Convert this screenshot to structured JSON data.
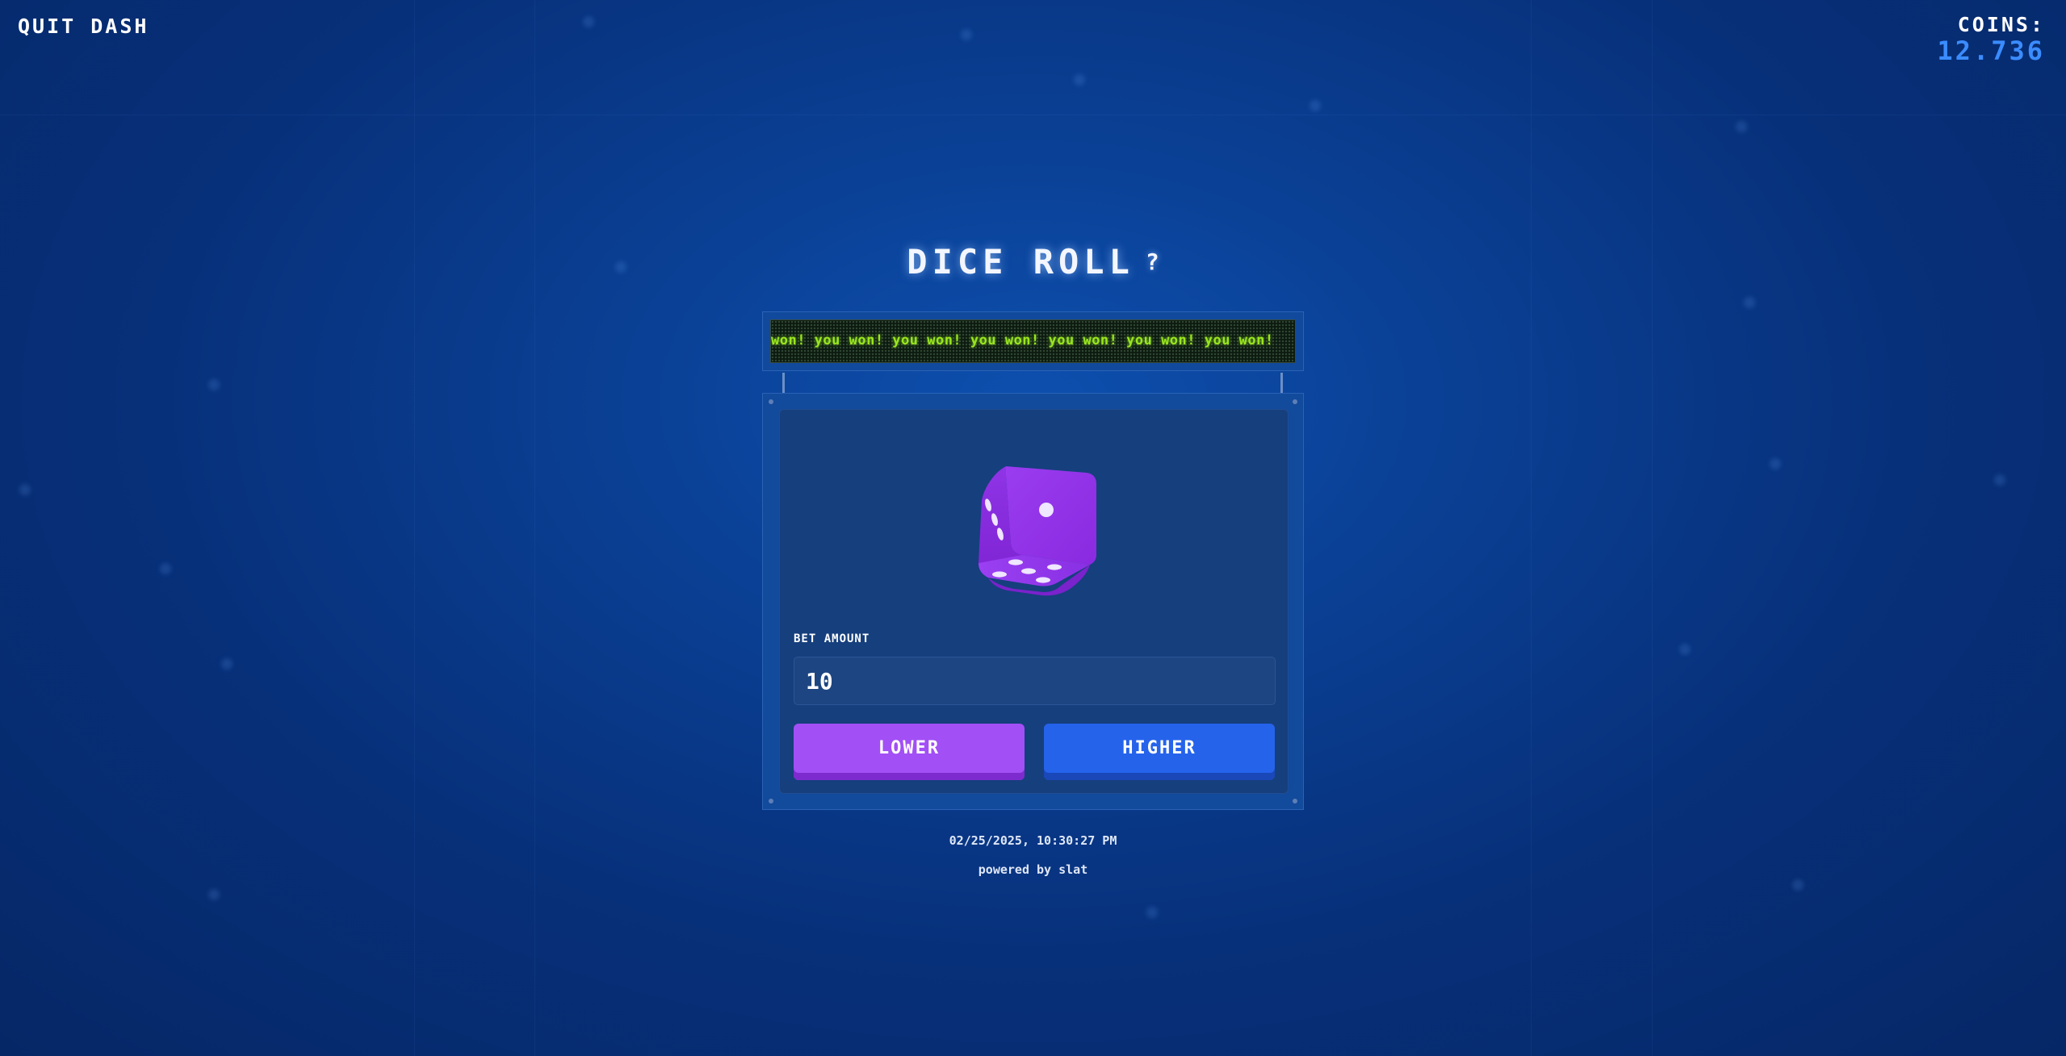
{
  "header": {
    "quit_label": "QUIT DASH",
    "coins_label": "COINS:",
    "coins_value": "12.736"
  },
  "game": {
    "title": "DICE ROLL",
    "help_label": "?",
    "marquee_text": "won!  you won!  you won!  you won!  you won!  you won!  you won!",
    "die_value": 1,
    "bet_label": "BET AMOUNT",
    "bet_value": "10",
    "lower_label": "LOWER",
    "higher_label": "HIGHER"
  },
  "footer": {
    "timestamp": "02/25/2025, 10:30:27 PM",
    "powered_by": "powered by slat"
  },
  "colors": {
    "background": "#0a3f93",
    "coins_value": "#3b8cff",
    "marquee_text": "#9ae61d",
    "die": "#8b2be2",
    "lower_button": "#a24ff5",
    "higher_button": "#2563eb"
  }
}
